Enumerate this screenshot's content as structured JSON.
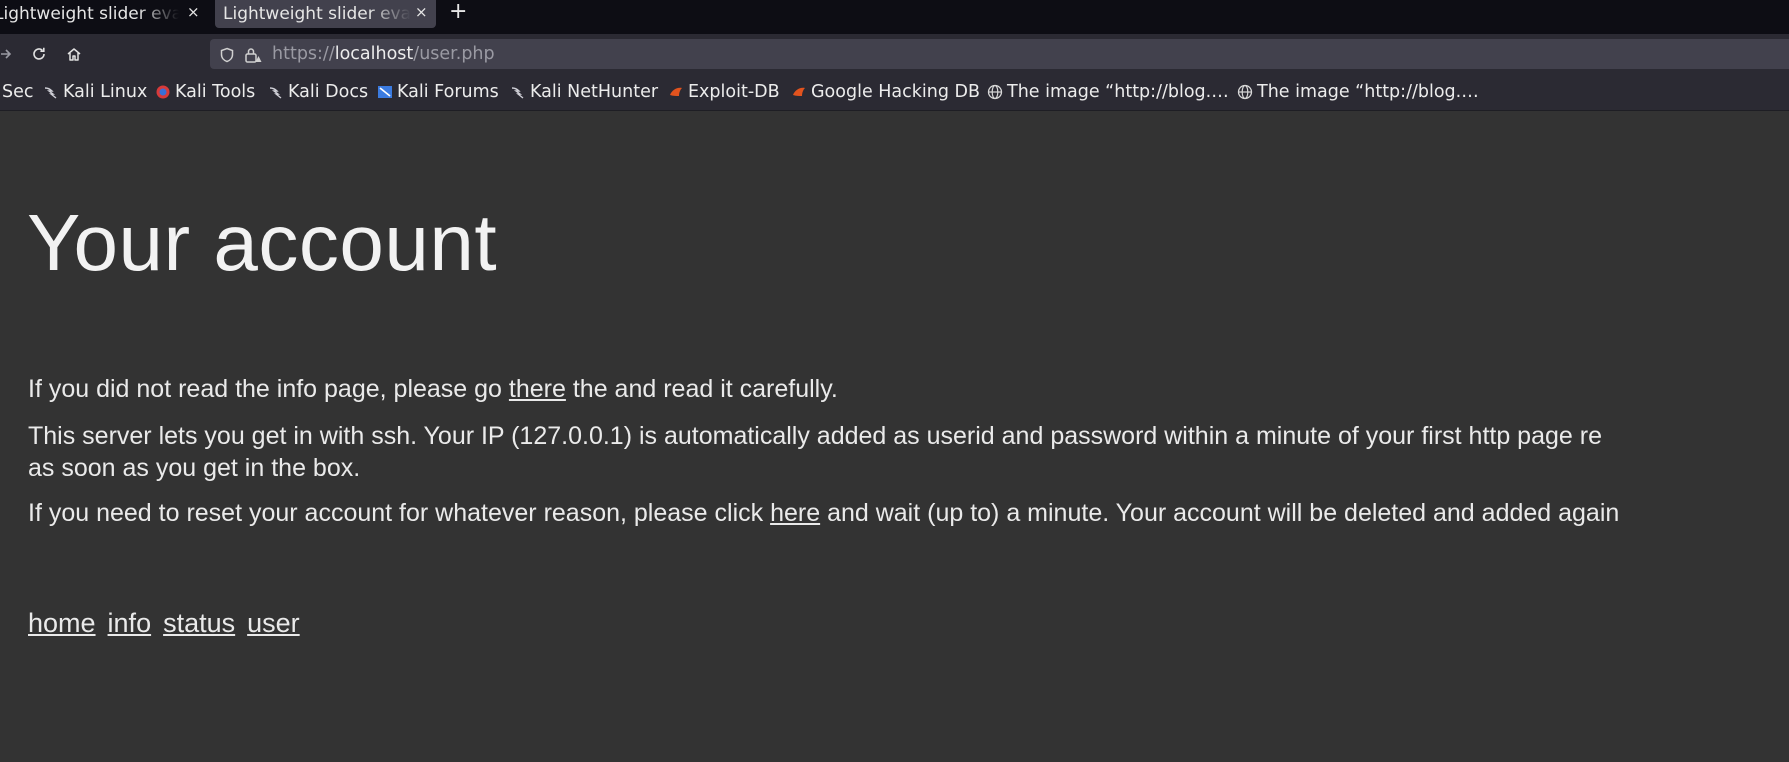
{
  "tabs": [
    {
      "title": "Lightweight slider eval",
      "close": "×",
      "active": false
    },
    {
      "title": "Lightweight slider eval",
      "close": "×",
      "active": true
    }
  ],
  "new_tab": "+",
  "url": {
    "scheme": "https://",
    "host": "localhost",
    "path": "/user.php"
  },
  "bookmarks": [
    {
      "label": "Sec",
      "icon": "offsec-icon"
    },
    {
      "label": "Kali Linux",
      "icon": "kali-dragon-icon"
    },
    {
      "label": "Kali Tools",
      "icon": "kali-tools-icon"
    },
    {
      "label": "Kali Docs",
      "icon": "kali-dragon-icon"
    },
    {
      "label": "Kali Forums",
      "icon": "kali-forums-icon"
    },
    {
      "label": "Kali NetHunter",
      "icon": "kali-dragon-icon"
    },
    {
      "label": "Exploit-DB",
      "icon": "exploit-db-icon"
    },
    {
      "label": "Google Hacking DB",
      "icon": "exploit-db-icon"
    },
    {
      "label": "The image “http://blog.…",
      "icon": "globe-icon"
    },
    {
      "label": "The image “http://blog.…",
      "icon": "globe-icon"
    }
  ],
  "page": {
    "title": "Your account",
    "para1": {
      "before": "If you did not read the info page, please go ",
      "link": "there",
      "after": " the and read it carefully."
    },
    "para2": {
      "line1": "This server lets you get in with ssh. Your IP (127.0.0.1) is automatically added as userid and password within a minute of your first http page re",
      "line2": "as soon as you get in the box."
    },
    "para3": {
      "before": "If you need to reset your account for whatever reason, please click ",
      "link": "here",
      "after": " and wait (up to) a minute. Your account will be deleted and added again"
    },
    "nav": [
      "home",
      "info",
      "status",
      "user"
    ]
  }
}
